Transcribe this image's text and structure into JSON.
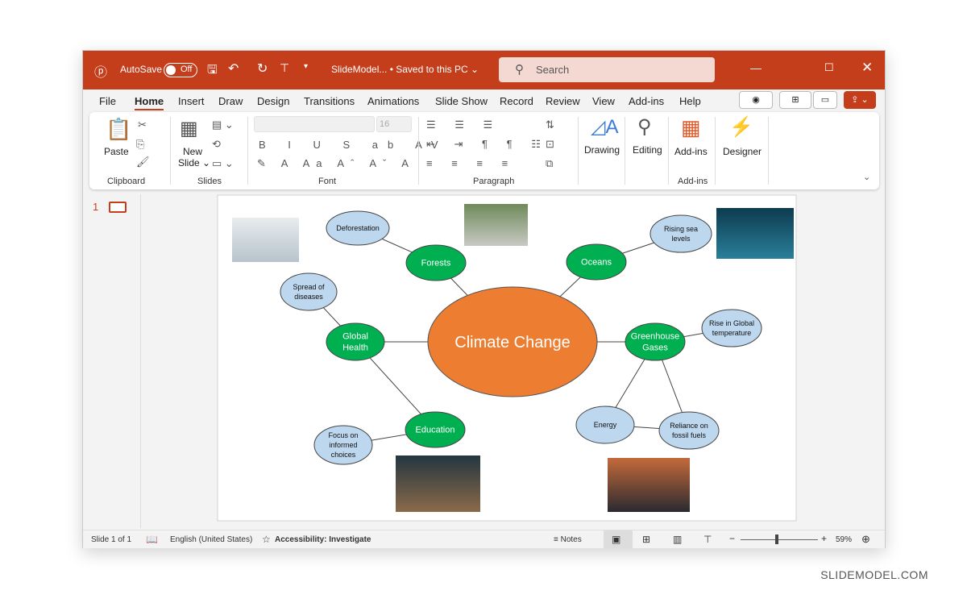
{
  "titlebar": {
    "autosave": "AutoSave",
    "toggle": "Off",
    "doc_title": "SlideModel... • Saved to this PC ⌄",
    "search_placeholder": "Search",
    "accent": "#C43E1C"
  },
  "tabs": [
    "File",
    "Home",
    "Insert",
    "Draw",
    "Design",
    "Transitions",
    "Animations",
    "Slide Show",
    "Record",
    "Review",
    "View",
    "Add-ins",
    "Help"
  ],
  "ribbon": {
    "paste": "Paste",
    "clipboard": "Clipboard",
    "new_slide": "New",
    "new_slide2": "Slide ⌄",
    "slides": "Slides",
    "font_size": "16",
    "font": "Font",
    "paragraph": "Paragraph",
    "drawing": "Drawing",
    "editing": "Editing",
    "addins_btn": "Add-ins",
    "addins": "Add-ins",
    "designer": "Designer"
  },
  "thumb": {
    "number": "1"
  },
  "slide": {
    "center": "Climate Change",
    "nodes": [
      "Forests",
      "Oceans",
      "Global|Health",
      "Greenhouse|Gases",
      "Education",
      "Deforestation",
      "Rising sea|levels",
      "Spread of|diseases",
      "Rise in Global|temperature",
      "Energy",
      "Reliance on|fossil fuels",
      "Focus on|informed|choices"
    ],
    "colors": {
      "center": "#ED7D31",
      "primary": "#00B050",
      "secondary": "#BDD7EE"
    }
  },
  "status": {
    "slide": "Slide 1 of 1",
    "language": "English (United States)",
    "accessibility": "Accessibility: Investigate",
    "notes": "Notes",
    "zoom": "59%",
    "zoom_level": 59
  },
  "watermark": "SLIDEMODEL.COM"
}
